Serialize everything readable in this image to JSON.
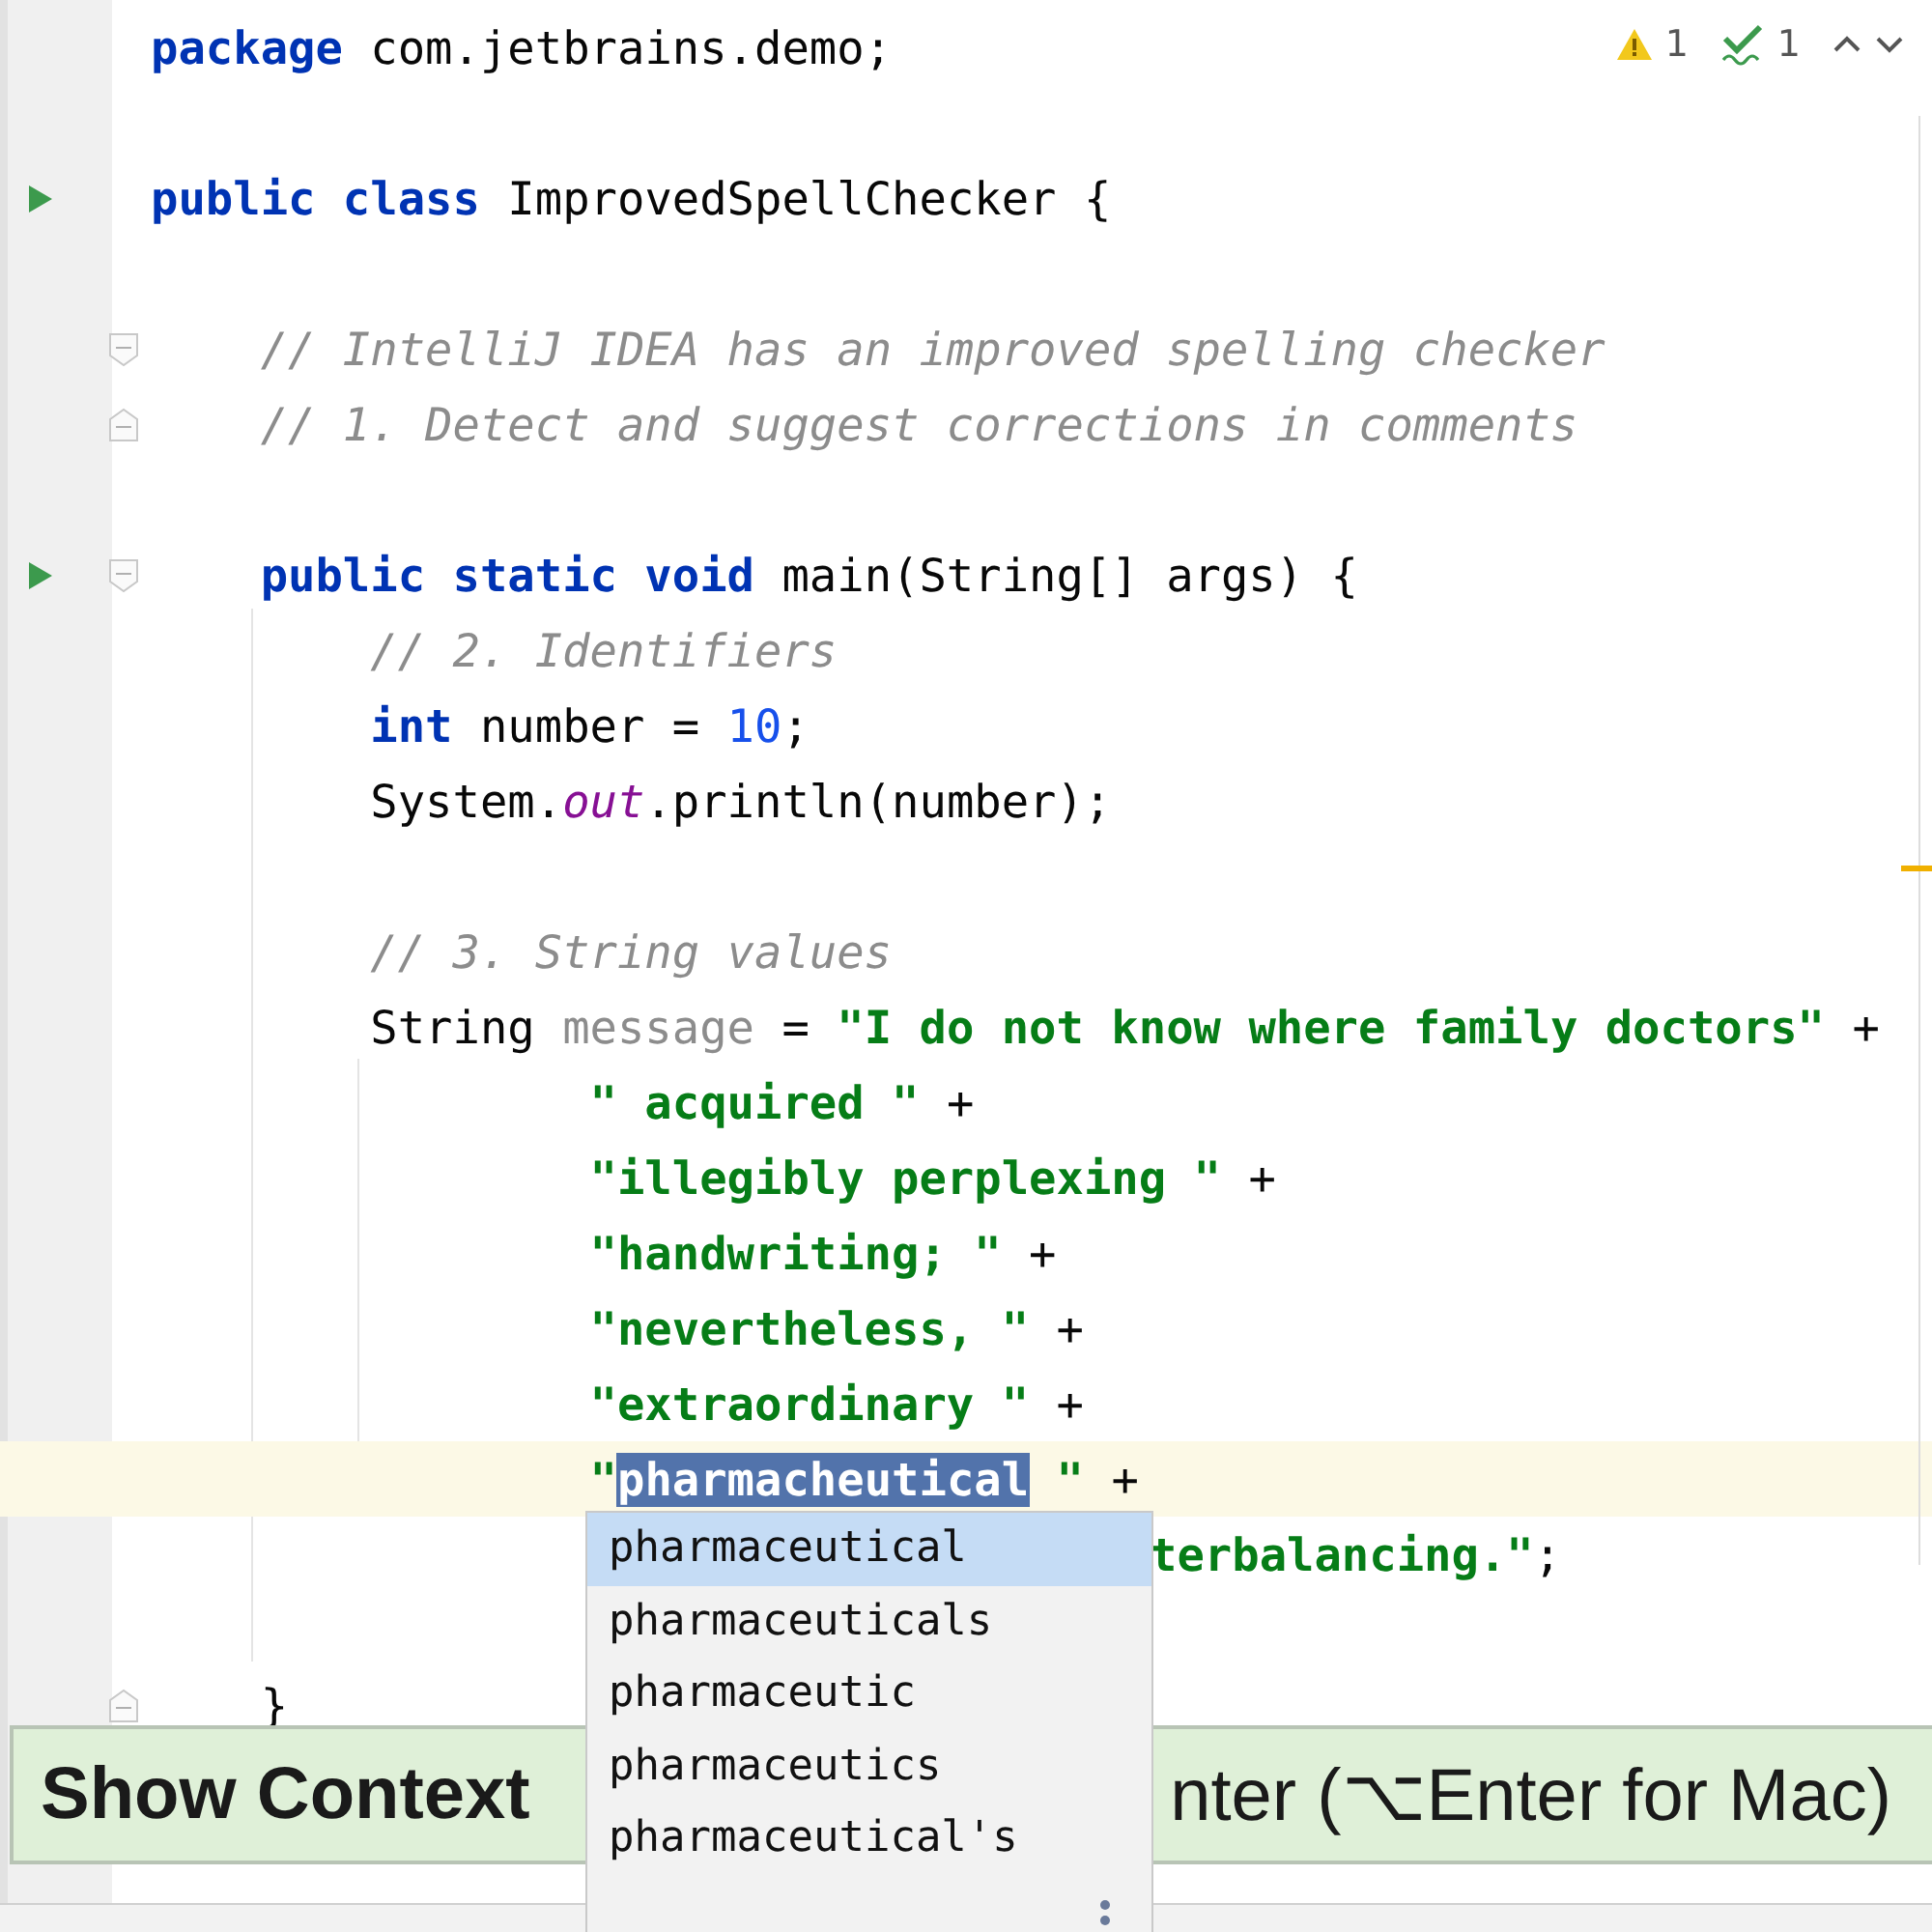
{
  "inspection_widget": {
    "warnings": "1",
    "typos": "1"
  },
  "code_lines": [
    {
      "kind": "code",
      "current": false,
      "tokens": [
        {
          "kind": "keyword",
          "text": "package"
        },
        {
          "kind": "plain",
          "text": " com.jetbrains.demo;"
        }
      ]
    },
    {
      "kind": "blank",
      "current": false
    },
    {
      "kind": "runnable",
      "current": false,
      "tokens": [
        {
          "kind": "keyword",
          "text": "public class"
        },
        {
          "kind": "plain",
          "text": " ImprovedSpellChecker {"
        }
      ],
      "children": [
        {
          "kind": "blank",
          "current": false
        },
        {
          "kind": "fold-start",
          "current": false,
          "tokens": [
            {
              "kind": "comment",
              "text": "// IntelliJ IDEA has an improved spelling checker"
            }
          ]
        },
        {
          "kind": "fold-end",
          "current": false,
          "tokens": [
            {
              "kind": "comment",
              "text": "// 1. Detect and suggest corrections in comments"
            }
          ]
        },
        {
          "kind": "blank",
          "current": false
        },
        {
          "kind": "runnable-fold-start",
          "current": false,
          "tokens": [
            {
              "kind": "keyword",
              "text": "public static void"
            },
            {
              "kind": "plain",
              "text": " main(String[] args) {"
            }
          ],
          "children": [
            {
              "kind": "code",
              "current": false,
              "tokens": [
                {
                  "kind": "comment",
                  "text": "// 2. Identifiers"
                }
              ]
            },
            {
              "kind": "code",
              "current": false,
              "tokens": [
                {
                  "kind": "keyword",
                  "text": "int"
                },
                {
                  "kind": "plain",
                  "text": " number = "
                },
                {
                  "kind": "number",
                  "text": "10"
                },
                {
                  "kind": "plain",
                  "text": ";"
                }
              ]
            },
            {
              "kind": "code",
              "current": false,
              "tokens": [
                {
                  "kind": "plain",
                  "text": "System."
                },
                {
                  "kind": "field",
                  "text": "out"
                },
                {
                  "kind": "plain",
                  "text": ".println(number);"
                }
              ]
            },
            {
              "kind": "blank",
              "current": false
            },
            {
              "kind": "code",
              "current": false,
              "tokens": [
                {
                  "kind": "comment",
                  "text": "// 3. String values"
                }
              ]
            },
            {
              "kind": "code",
              "current": false,
              "tokens": [
                {
                  "kind": "plain",
                  "text": "String "
                },
                {
                  "kind": "unused",
                  "text": "message"
                },
                {
                  "kind": "plain",
                  "text": " = "
                },
                {
                  "kind": "string",
                  "text": "\"I do not know where family doctors\""
                },
                {
                  "kind": "plain",
                  "text": " +"
                }
              ],
              "children": [
                {
                  "kind": "code",
                  "current": false,
                  "tokens": [
                    {
                      "kind": "string",
                      "text": "\" acquired \""
                    },
                    {
                      "kind": "plain",
                      "text": " +"
                    }
                  ]
                },
                {
                  "kind": "code",
                  "current": false,
                  "tokens": [
                    {
                      "kind": "string",
                      "text": "\"illegibly perplexing \""
                    },
                    {
                      "kind": "plain",
                      "text": " +"
                    }
                  ]
                },
                {
                  "kind": "code",
                  "current": false,
                  "tokens": [
                    {
                      "kind": "string",
                      "text": "\"handwriting; \""
                    },
                    {
                      "kind": "plain",
                      "text": " +"
                    }
                  ]
                },
                {
                  "kind": "code",
                  "current": false,
                  "tokens": [
                    {
                      "kind": "string",
                      "text": "\"nevertheless, \""
                    },
                    {
                      "kind": "plain",
                      "text": " +"
                    }
                  ]
                },
                {
                  "kind": "code",
                  "current": false,
                  "tokens": [
                    {
                      "kind": "string",
                      "text": "\"extraordinary \""
                    },
                    {
                      "kind": "plain",
                      "text": " +"
                    }
                  ]
                },
                {
                  "kind": "code",
                  "current": true,
                  "tokens": [
                    {
                      "kind": "string",
                      "text": "\""
                    },
                    {
                      "kind": "typo-selected",
                      "text": "pharmacheutical"
                    },
                    {
                      "kind": "string",
                      "text": " \""
                    },
                    {
                      "kind": "plain",
                      "text": " +"
                    }
                  ]
                },
                {
                  "kind": "covered",
                  "current": false,
                  "tokens": [
                    {
                      "kind": "string",
                      "text": "terbalancing.\""
                    },
                    {
                      "kind": "plain",
                      "text": ";"
                    }
                  ]
                }
              ]
            },
            {
              "kind": "blank",
              "current": false
            }
          ]
        },
        {
          "kind": "fold-end",
          "current": false,
          "tokens": [
            {
              "kind": "plain",
              "text": "}"
            }
          ]
        }
      ]
    }
  ],
  "suggestions": [
    {
      "text": "pharmaceutical",
      "selected": true
    },
    {
      "text": "pharmaceuticals",
      "selected": false
    },
    {
      "text": "pharmaceutic",
      "selected": false
    },
    {
      "text": "pharmaceutics",
      "selected": false
    },
    {
      "text": "pharmaceutical's",
      "selected": false
    }
  ],
  "hint_banner": {
    "visible_start": "Show Context",
    "visible_end": "nter (⌥Enter for Mac)"
  }
}
